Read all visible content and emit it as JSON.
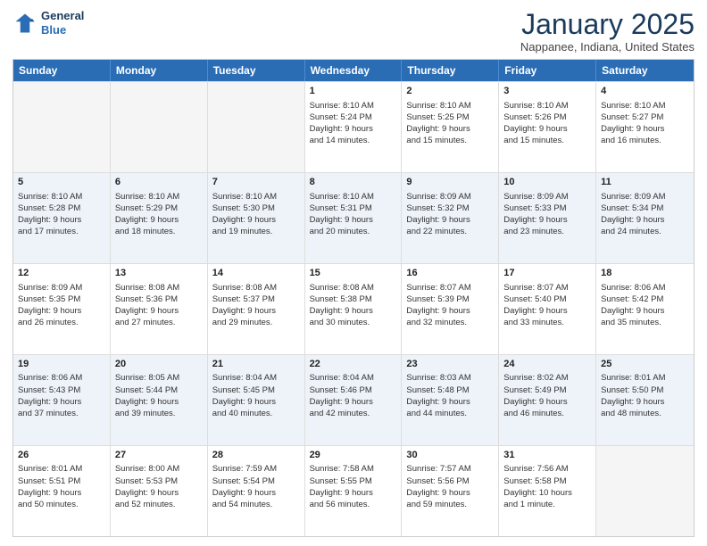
{
  "header": {
    "logo_line1": "General",
    "logo_line2": "Blue",
    "month": "January 2025",
    "location": "Nappanee, Indiana, United States"
  },
  "weekdays": [
    "Sunday",
    "Monday",
    "Tuesday",
    "Wednesday",
    "Thursday",
    "Friday",
    "Saturday"
  ],
  "weeks": [
    [
      {
        "day": "",
        "info": "",
        "empty": true
      },
      {
        "day": "",
        "info": "",
        "empty": true
      },
      {
        "day": "",
        "info": "",
        "empty": true
      },
      {
        "day": "1",
        "info": "Sunrise: 8:10 AM\nSunset: 5:24 PM\nDaylight: 9 hours\nand 14 minutes."
      },
      {
        "day": "2",
        "info": "Sunrise: 8:10 AM\nSunset: 5:25 PM\nDaylight: 9 hours\nand 15 minutes."
      },
      {
        "day": "3",
        "info": "Sunrise: 8:10 AM\nSunset: 5:26 PM\nDaylight: 9 hours\nand 15 minutes."
      },
      {
        "day": "4",
        "info": "Sunrise: 8:10 AM\nSunset: 5:27 PM\nDaylight: 9 hours\nand 16 minutes."
      }
    ],
    [
      {
        "day": "5",
        "info": "Sunrise: 8:10 AM\nSunset: 5:28 PM\nDaylight: 9 hours\nand 17 minutes."
      },
      {
        "day": "6",
        "info": "Sunrise: 8:10 AM\nSunset: 5:29 PM\nDaylight: 9 hours\nand 18 minutes."
      },
      {
        "day": "7",
        "info": "Sunrise: 8:10 AM\nSunset: 5:30 PM\nDaylight: 9 hours\nand 19 minutes."
      },
      {
        "day": "8",
        "info": "Sunrise: 8:10 AM\nSunset: 5:31 PM\nDaylight: 9 hours\nand 20 minutes."
      },
      {
        "day": "9",
        "info": "Sunrise: 8:09 AM\nSunset: 5:32 PM\nDaylight: 9 hours\nand 22 minutes."
      },
      {
        "day": "10",
        "info": "Sunrise: 8:09 AM\nSunset: 5:33 PM\nDaylight: 9 hours\nand 23 minutes."
      },
      {
        "day": "11",
        "info": "Sunrise: 8:09 AM\nSunset: 5:34 PM\nDaylight: 9 hours\nand 24 minutes."
      }
    ],
    [
      {
        "day": "12",
        "info": "Sunrise: 8:09 AM\nSunset: 5:35 PM\nDaylight: 9 hours\nand 26 minutes."
      },
      {
        "day": "13",
        "info": "Sunrise: 8:08 AM\nSunset: 5:36 PM\nDaylight: 9 hours\nand 27 minutes."
      },
      {
        "day": "14",
        "info": "Sunrise: 8:08 AM\nSunset: 5:37 PM\nDaylight: 9 hours\nand 29 minutes."
      },
      {
        "day": "15",
        "info": "Sunrise: 8:08 AM\nSunset: 5:38 PM\nDaylight: 9 hours\nand 30 minutes."
      },
      {
        "day": "16",
        "info": "Sunrise: 8:07 AM\nSunset: 5:39 PM\nDaylight: 9 hours\nand 32 minutes."
      },
      {
        "day": "17",
        "info": "Sunrise: 8:07 AM\nSunset: 5:40 PM\nDaylight: 9 hours\nand 33 minutes."
      },
      {
        "day": "18",
        "info": "Sunrise: 8:06 AM\nSunset: 5:42 PM\nDaylight: 9 hours\nand 35 minutes."
      }
    ],
    [
      {
        "day": "19",
        "info": "Sunrise: 8:06 AM\nSunset: 5:43 PM\nDaylight: 9 hours\nand 37 minutes."
      },
      {
        "day": "20",
        "info": "Sunrise: 8:05 AM\nSunset: 5:44 PM\nDaylight: 9 hours\nand 39 minutes."
      },
      {
        "day": "21",
        "info": "Sunrise: 8:04 AM\nSunset: 5:45 PM\nDaylight: 9 hours\nand 40 minutes."
      },
      {
        "day": "22",
        "info": "Sunrise: 8:04 AM\nSunset: 5:46 PM\nDaylight: 9 hours\nand 42 minutes."
      },
      {
        "day": "23",
        "info": "Sunrise: 8:03 AM\nSunset: 5:48 PM\nDaylight: 9 hours\nand 44 minutes."
      },
      {
        "day": "24",
        "info": "Sunrise: 8:02 AM\nSunset: 5:49 PM\nDaylight: 9 hours\nand 46 minutes."
      },
      {
        "day": "25",
        "info": "Sunrise: 8:01 AM\nSunset: 5:50 PM\nDaylight: 9 hours\nand 48 minutes."
      }
    ],
    [
      {
        "day": "26",
        "info": "Sunrise: 8:01 AM\nSunset: 5:51 PM\nDaylight: 9 hours\nand 50 minutes."
      },
      {
        "day": "27",
        "info": "Sunrise: 8:00 AM\nSunset: 5:53 PM\nDaylight: 9 hours\nand 52 minutes."
      },
      {
        "day": "28",
        "info": "Sunrise: 7:59 AM\nSunset: 5:54 PM\nDaylight: 9 hours\nand 54 minutes."
      },
      {
        "day": "29",
        "info": "Sunrise: 7:58 AM\nSunset: 5:55 PM\nDaylight: 9 hours\nand 56 minutes."
      },
      {
        "day": "30",
        "info": "Sunrise: 7:57 AM\nSunset: 5:56 PM\nDaylight: 9 hours\nand 59 minutes."
      },
      {
        "day": "31",
        "info": "Sunrise: 7:56 AM\nSunset: 5:58 PM\nDaylight: 10 hours\nand 1 minute."
      },
      {
        "day": "",
        "info": "",
        "empty": true
      }
    ]
  ]
}
